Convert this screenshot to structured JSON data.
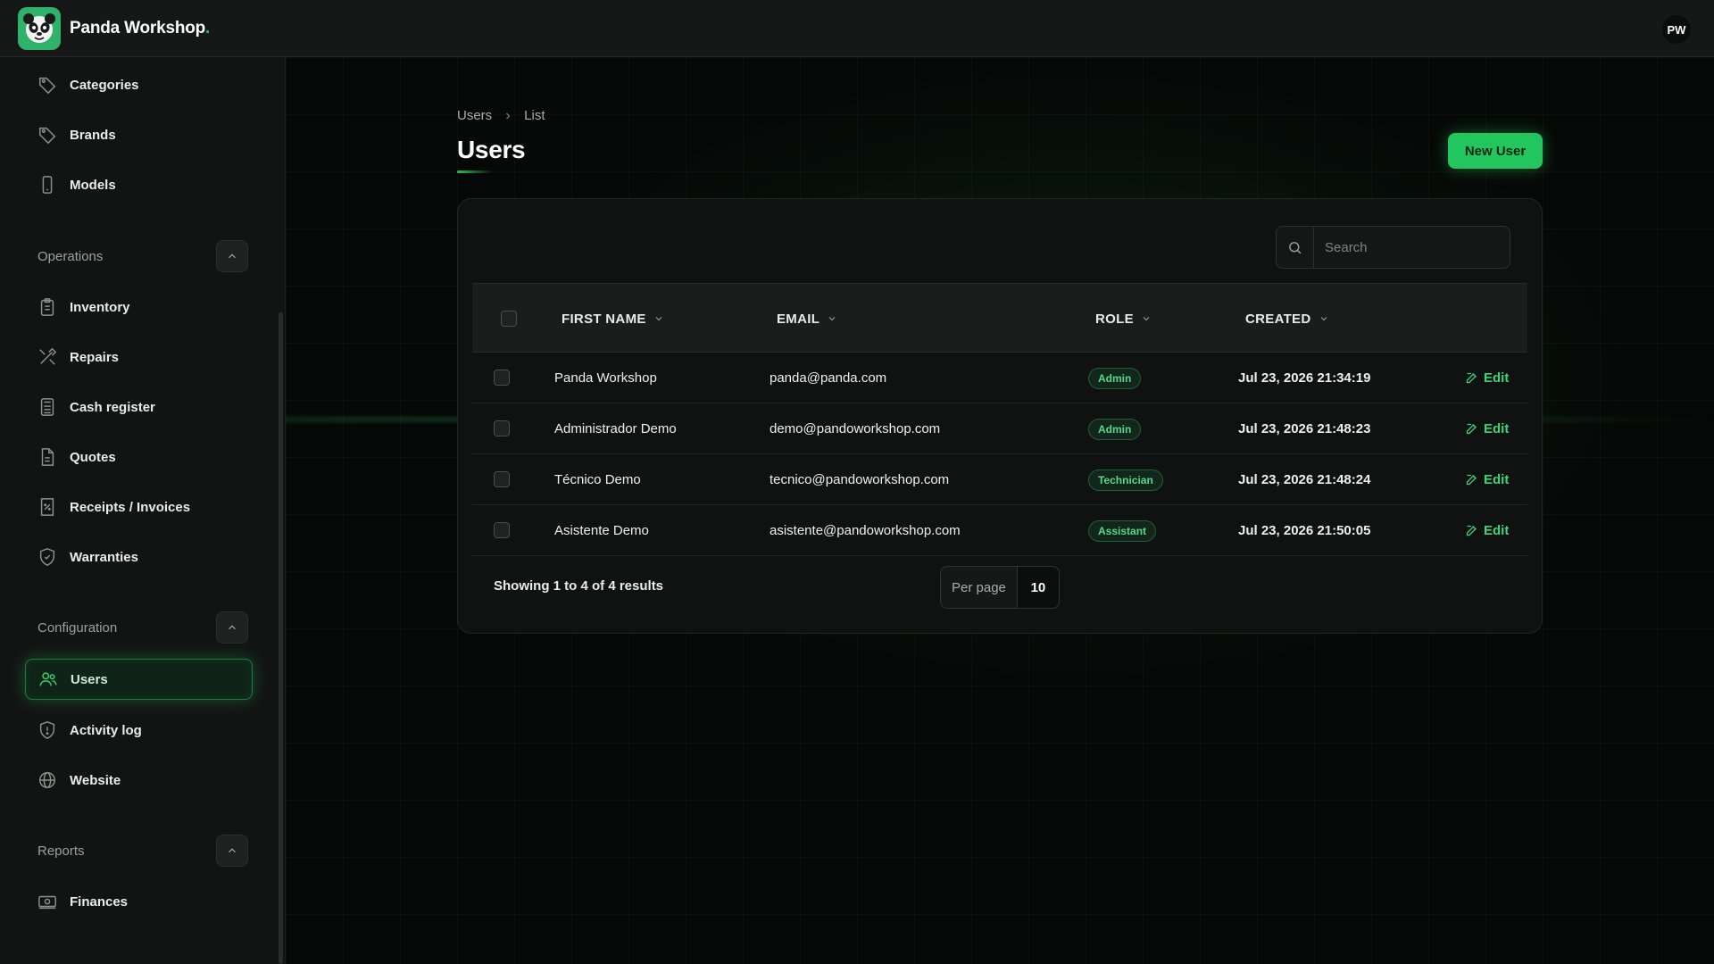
{
  "app": {
    "brand_name": "Panda Workshop",
    "brand_suffix": ".",
    "user_initials": "PW",
    "accent_color": "#22c55e"
  },
  "sidebar": {
    "top_items": [
      {
        "label": "Categories",
        "icon": "tag-icon"
      },
      {
        "label": "Brands",
        "icon": "tag-icon"
      },
      {
        "label": "Models",
        "icon": "device-mobile-icon"
      }
    ],
    "groups": {
      "operations": {
        "label": "Operations",
        "items": [
          {
            "label": "Inventory",
            "icon": "clipboard-list-icon"
          },
          {
            "label": "Repairs",
            "icon": "tools-icon"
          },
          {
            "label": "Cash register",
            "icon": "calculator-icon"
          },
          {
            "label": "Quotes",
            "icon": "document-icon"
          },
          {
            "label": "Receipts / Invoices",
            "icon": "receipt-percent-icon"
          },
          {
            "label": "Warranties",
            "icon": "shield-check-icon"
          }
        ]
      },
      "configuration": {
        "label": "Configuration",
        "items": [
          {
            "label": "Users",
            "icon": "users-icon",
            "active": true
          },
          {
            "label": "Activity log",
            "icon": "shield-exclamation-icon"
          },
          {
            "label": "Website",
            "icon": "globe-icon"
          }
        ]
      },
      "reports": {
        "label": "Reports",
        "items": [
          {
            "label": "Finances",
            "icon": "banknotes-icon"
          }
        ]
      }
    }
  },
  "breadcrumb": {
    "first": "Users",
    "second": "List"
  },
  "page": {
    "title": "Users",
    "new_button": "New User"
  },
  "search": {
    "placeholder": "Search",
    "value": ""
  },
  "table": {
    "columns": {
      "first_name": "FIRST NAME",
      "email": "EMAIL",
      "role": "ROLE",
      "created": "CREATED"
    },
    "edit_label": "Edit",
    "rows": [
      {
        "first_name": "Panda Workshop",
        "email": "panda@panda.com",
        "role": "Admin",
        "created": "Jul 23, 2026 21:34:19"
      },
      {
        "first_name": "Administrador Demo",
        "email": "demo@pandoworkshop.com",
        "role": "Admin",
        "created": "Jul 23, 2026 21:48:23"
      },
      {
        "first_name": "Técnico Demo",
        "email": "tecnico@pandoworkshop.com",
        "role": "Technician",
        "created": "Jul 23, 2026 21:48:24"
      },
      {
        "first_name": "Asistente Demo",
        "email": "asistente@pandoworkshop.com",
        "role": "Assistant",
        "created": "Jul 23, 2026 21:50:05"
      }
    ]
  },
  "pagination": {
    "results_text": "Showing 1 to 4 of 4 results",
    "per_page_label": "Per page",
    "per_page_value": "10"
  }
}
